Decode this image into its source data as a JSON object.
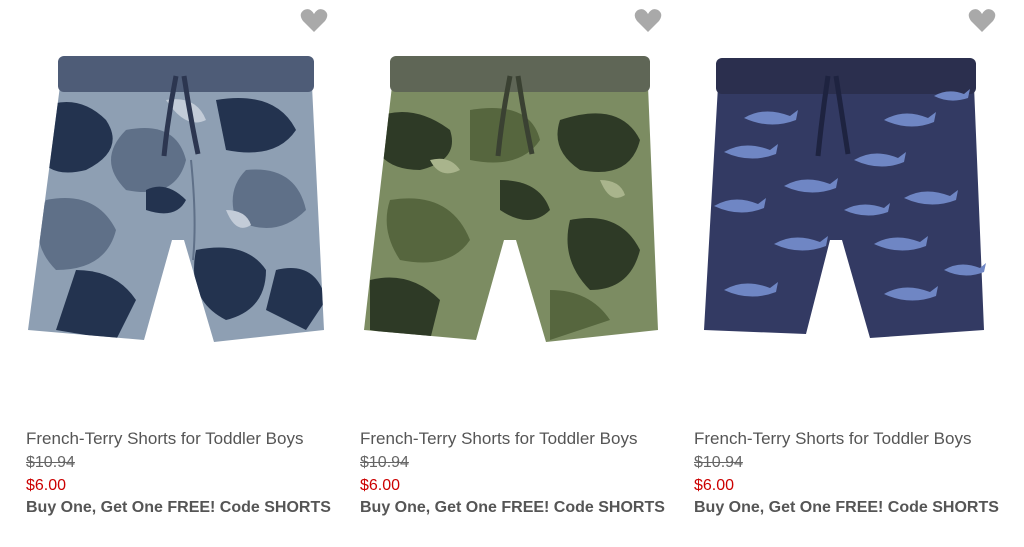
{
  "products": [
    {
      "title": "French-Terry Shorts for Toddler Boys",
      "original_price": "$10.94",
      "sale_price": "$6.00",
      "promo": "Buy One, Get One FREE! Code SHORTS",
      "image": "blue-camo-shorts",
      "colors": {
        "waistband": "#4e5c77",
        "base": "#8e9fb3",
        "dark": "#23334f",
        "mid": "#5f7088"
      }
    },
    {
      "title": "French-Terry Shorts for Toddler Boys",
      "original_price": "$10.94",
      "sale_price": "$6.00",
      "promo": "Buy One, Get One FREE! Code SHORTS",
      "image": "green-camo-shorts",
      "colors": {
        "waistband": "#5f6656",
        "base": "#7c8c62",
        "dark": "#2e3a26",
        "mid": "#56663e"
      }
    },
    {
      "title": "French-Terry Shorts for Toddler Boys",
      "original_price": "$10.94",
      "sale_price": "$6.00",
      "promo": "Buy One, Get One FREE! Code SHORTS",
      "image": "navy-shark-print-shorts",
      "colors": {
        "waistband": "#2b2f4e",
        "base": "#333a63",
        "dark": "#1e2340",
        "mid": "#6f86c4"
      }
    }
  ],
  "ui": {
    "favorite_icon": "heart-icon",
    "heart_color": "#a9a9a9",
    "sale_color": "#cc0000"
  }
}
